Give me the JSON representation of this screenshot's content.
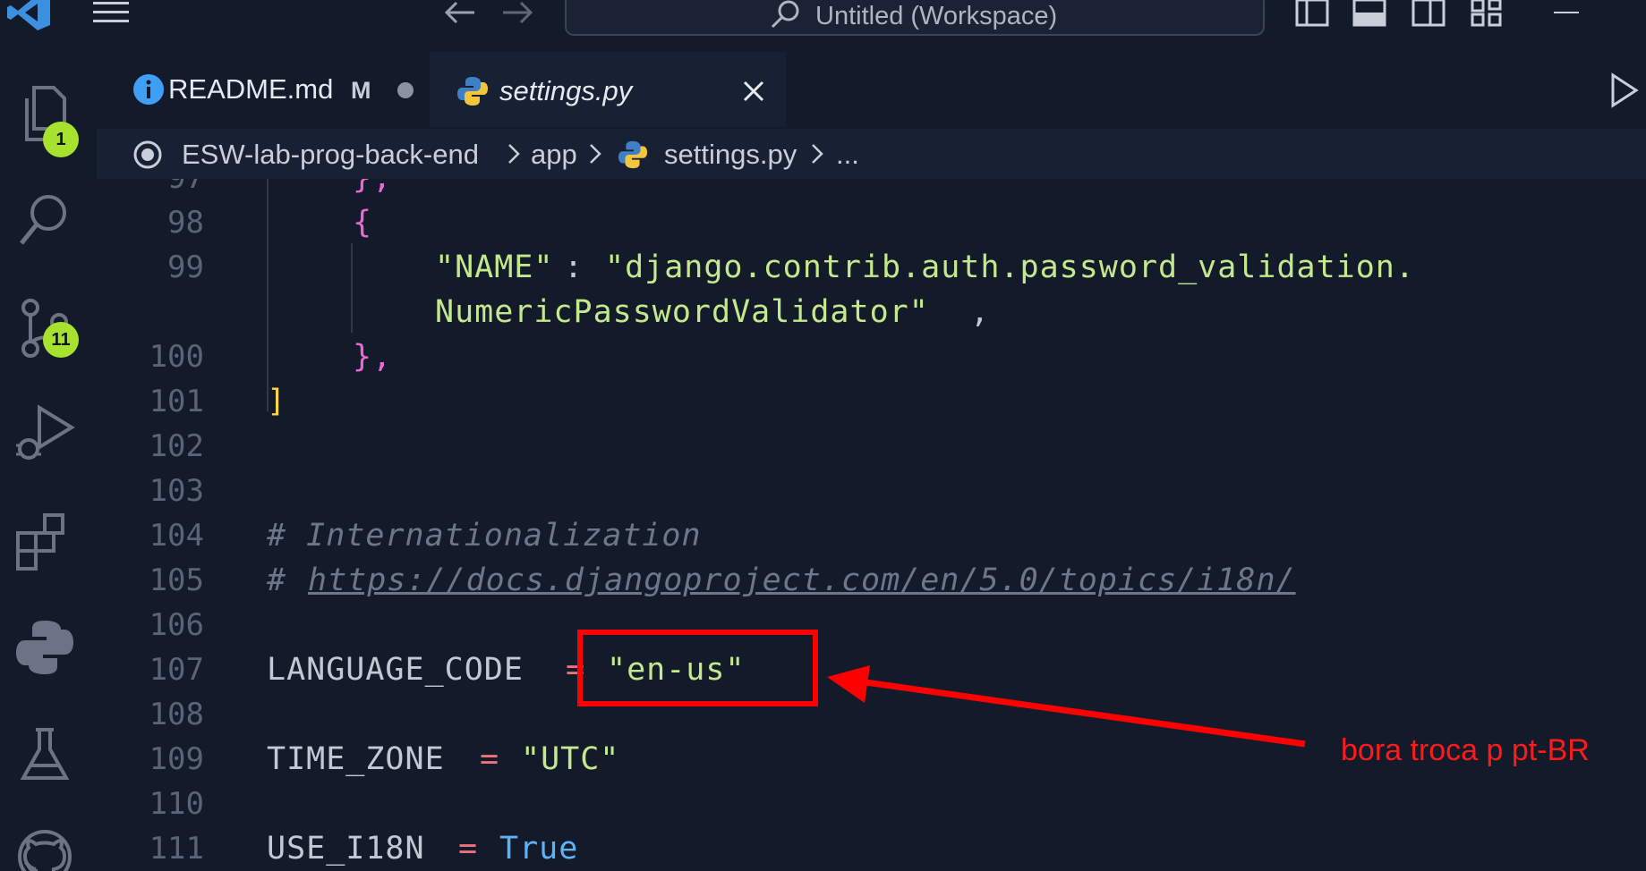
{
  "window": {
    "title": "Untitled (Workspace)"
  },
  "activity_bar": {
    "explorer_badge": "1",
    "source_control_badge": "11"
  },
  "tabs": [
    {
      "label": "README.md",
      "modified_marker": "M",
      "icon": "info-icon"
    },
    {
      "label": "settings.py",
      "icon": "python-icon",
      "active": true
    }
  ],
  "breadcrumb": {
    "segments": [
      "ESW-lab-prog-back-end",
      "app",
      "settings.py",
      "..."
    ]
  },
  "editor": {
    "lines": [
      {
        "number": "97",
        "text": "},"
      },
      {
        "number": "98",
        "text": "{"
      },
      {
        "number": "99",
        "key": "\"NAME\"",
        "colon": ":",
        "value": "\"django.contrib.auth.password_validation.",
        "continuation": "NumericPasswordValidator\"",
        "trail": ","
      },
      {
        "number": "100",
        "text": "},"
      },
      {
        "number": "101",
        "text": "]"
      },
      {
        "number": "102"
      },
      {
        "number": "103"
      },
      {
        "number": "104",
        "comment": "# Internationalization"
      },
      {
        "number": "105",
        "comment_hash": "# ",
        "link": "https://docs.djangoproject.com/en/5.0/topics/i18n/"
      },
      {
        "number": "106"
      },
      {
        "number": "107",
        "name": "LANGUAGE_CODE",
        "op": "=",
        "value": "\"en-us\""
      },
      {
        "number": "108"
      },
      {
        "number": "109",
        "name": "TIME_ZONE",
        "op": "=",
        "value": "\"UTC\""
      },
      {
        "number": "110"
      },
      {
        "number": "111",
        "name": "USE_I18N",
        "op": "=",
        "value": "True"
      }
    ]
  },
  "annotation": {
    "text": "bora troca p pt-BR",
    "color": "#ff0000"
  },
  "colors": {
    "background": "#131b2b",
    "badge": "#a7e22e",
    "string": "#c3e88d",
    "operator": "#f07178",
    "keyword": "#5fb3f5"
  }
}
